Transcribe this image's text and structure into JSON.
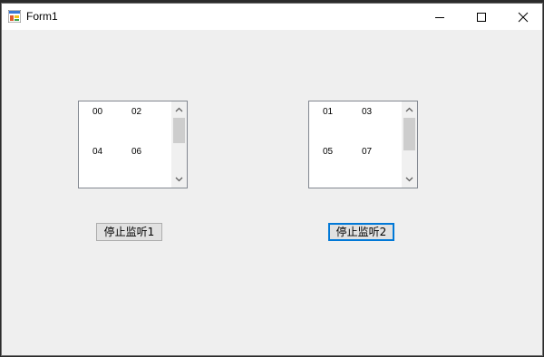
{
  "window": {
    "title": "Form1",
    "controls": [
      "minimize-icon",
      "maximize-icon",
      "close-icon"
    ]
  },
  "listbox1": {
    "items": [
      "00",
      "02",
      "04",
      "06"
    ]
  },
  "listbox2": {
    "items": [
      "01",
      "03",
      "05",
      "07"
    ]
  },
  "buttons": {
    "stop_listen_1": "停止监听1",
    "stop_listen_2": "停止监听2"
  },
  "colors": {
    "focus_border": "#0078d7",
    "window_bg": "#f0f0f0"
  }
}
